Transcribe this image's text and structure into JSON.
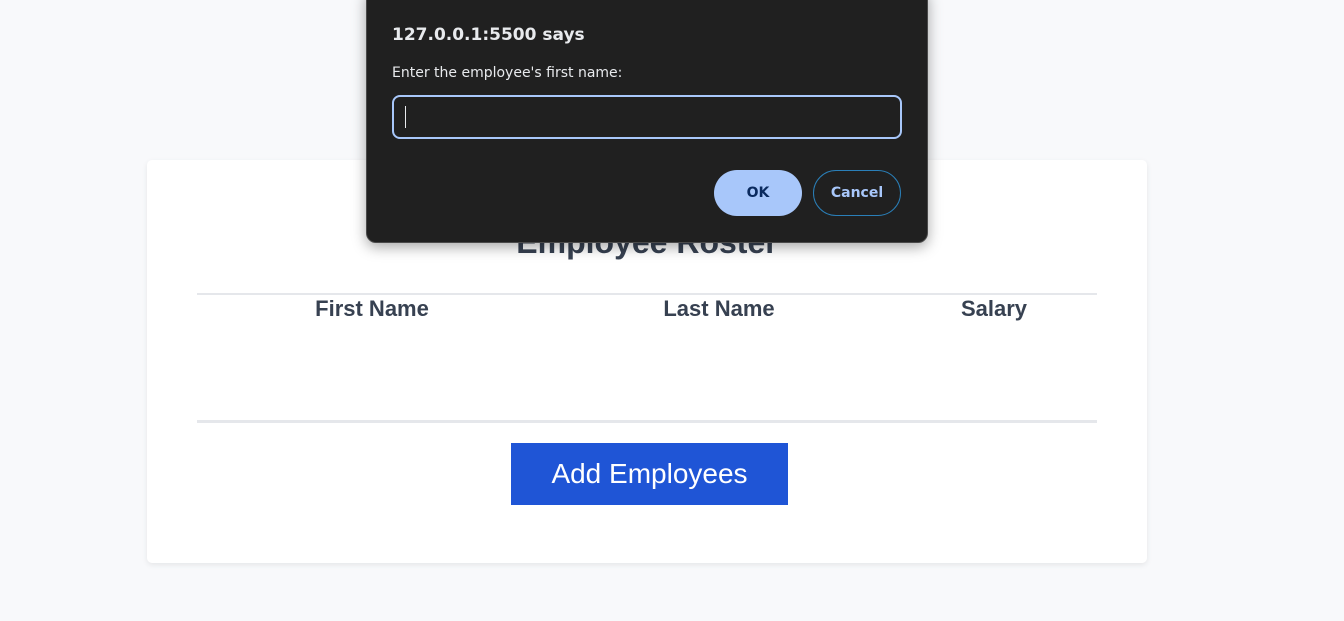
{
  "roster": {
    "title": "Employee Roster",
    "columns": [
      "First Name",
      "Last Name",
      "Salary"
    ],
    "rows": [],
    "add_button_label": "Add Employees"
  },
  "dialog": {
    "title": "127.0.0.1:5500 says",
    "message": "Enter the employee's first name:",
    "input_value": "",
    "ok_label": "OK",
    "cancel_label": "Cancel"
  },
  "colors": {
    "page_background": "#f8f9fb",
    "primary_button": "#1f55d6",
    "dialog_background": "#202020",
    "dialog_accent": "#a8c7fa",
    "heading_text": "#374151"
  }
}
